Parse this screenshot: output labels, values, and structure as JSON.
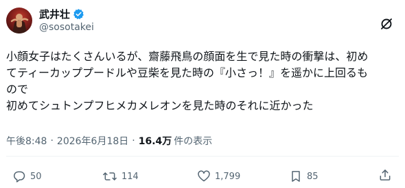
{
  "author": {
    "display_name": "武井壮",
    "handle": "@sosotakei",
    "verified": true,
    "avatar_icon": "avatar-photo"
  },
  "tweet": {
    "lines": [
      "小顔女子はたくさんいるが、齋藤飛鳥の顔面を生で見た時の衝撃は、初め",
      "てティーカッププードルや豆柴を見た時の『小さっ！』を遥かに上回るも",
      "ので",
      "初めてシュトンプフヒメカメレオンを見た時のそれに近かった"
    ]
  },
  "meta": {
    "time": "午後8:48",
    "separator": "·",
    "date": "2026年6月18日",
    "views_count": "16.4万",
    "views_label": "件の表示"
  },
  "actions": {
    "replies": "50",
    "reposts": "114",
    "likes": "1,799",
    "bookmarks": "85"
  },
  "icons": {
    "grok": "grok-slash-circle-icon",
    "reply": "reply-bubble-icon",
    "repost": "repost-arrows-icon",
    "like": "heart-icon",
    "bookmark": "bookmark-icon",
    "share": "share-upload-icon"
  },
  "colors": {
    "text_primary": "#0f1419",
    "text_secondary": "#536471",
    "verified_blue": "#1d9bf0",
    "divider": "#eff3f4"
  }
}
